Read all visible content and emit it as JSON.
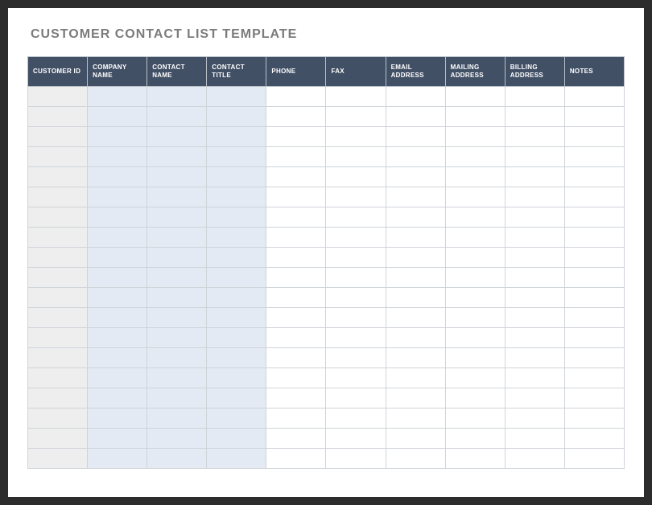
{
  "title": "CUSTOMER CONTACT LIST TEMPLATE",
  "columns": [
    "CUSTOMER ID",
    "COMPANY NAME",
    "CONTACT NAME",
    "CONTACT TITLE",
    "PHONE",
    "FAX",
    "EMAIL ADDRESS",
    "MAILING ADDRESS",
    "BILLING ADDRESS",
    "NOTES"
  ],
  "rows": [
    [
      "",
      "",
      "",
      "",
      "",
      "",
      "",
      "",
      "",
      ""
    ],
    [
      "",
      "",
      "",
      "",
      "",
      "",
      "",
      "",
      "",
      ""
    ],
    [
      "",
      "",
      "",
      "",
      "",
      "",
      "",
      "",
      "",
      ""
    ],
    [
      "",
      "",
      "",
      "",
      "",
      "",
      "",
      "",
      "",
      ""
    ],
    [
      "",
      "",
      "",
      "",
      "",
      "",
      "",
      "",
      "",
      ""
    ],
    [
      "",
      "",
      "",
      "",
      "",
      "",
      "",
      "",
      "",
      ""
    ],
    [
      "",
      "",
      "",
      "",
      "",
      "",
      "",
      "",
      "",
      ""
    ],
    [
      "",
      "",
      "",
      "",
      "",
      "",
      "",
      "",
      "",
      ""
    ],
    [
      "",
      "",
      "",
      "",
      "",
      "",
      "",
      "",
      "",
      ""
    ],
    [
      "",
      "",
      "",
      "",
      "",
      "",
      "",
      "",
      "",
      ""
    ],
    [
      "",
      "",
      "",
      "",
      "",
      "",
      "",
      "",
      "",
      ""
    ],
    [
      "",
      "",
      "",
      "",
      "",
      "",
      "",
      "",
      "",
      ""
    ],
    [
      "",
      "",
      "",
      "",
      "",
      "",
      "",
      "",
      "",
      ""
    ],
    [
      "",
      "",
      "",
      "",
      "",
      "",
      "",
      "",
      "",
      ""
    ],
    [
      "",
      "",
      "",
      "",
      "",
      "",
      "",
      "",
      "",
      ""
    ],
    [
      "",
      "",
      "",
      "",
      "",
      "",
      "",
      "",
      "",
      ""
    ],
    [
      "",
      "",
      "",
      "",
      "",
      "",
      "",
      "",
      "",
      ""
    ],
    [
      "",
      "",
      "",
      "",
      "",
      "",
      "",
      "",
      "",
      ""
    ],
    [
      "",
      "",
      "",
      "",
      "",
      "",
      "",
      "",
      "",
      ""
    ]
  ],
  "colors": {
    "header_bg": "#425066",
    "id_col_bg": "#eeeeee",
    "tint_col_bg": "#e4eaf3",
    "border": "#cfd4d9"
  }
}
